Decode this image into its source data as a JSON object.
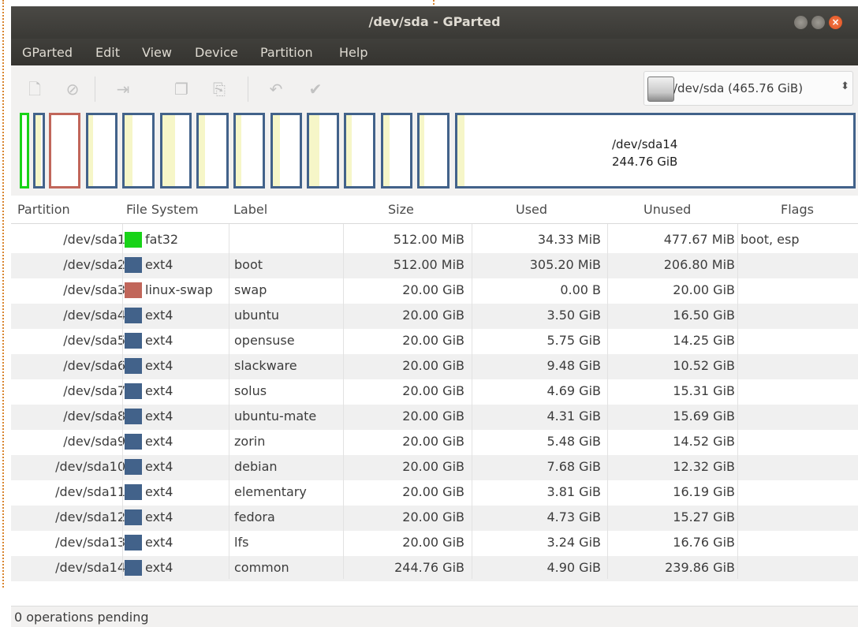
{
  "window": {
    "title": "/dev/sda - GParted"
  },
  "menu": [
    "GParted",
    "Edit",
    "View",
    "Device",
    "Partition",
    "Help"
  ],
  "toolbar": {
    "icons": [
      "new-partition-icon",
      "delete-icon",
      "resize-move-icon",
      "copy-icon",
      "paste-icon",
      "undo-icon",
      "apply-icon"
    ],
    "device": {
      "label": "/dev/sda  (465.76 GiB)",
      "selected": "/dev/sda"
    }
  },
  "partition_map": {
    "highlight_label": "/dev/sda14",
    "highlight_size": "244.76 GiB"
  },
  "table": {
    "columns": [
      "Partition",
      "File System",
      "Label",
      "Size",
      "Used",
      "Unused",
      "Flags"
    ],
    "rows": [
      {
        "partition": "/dev/sda1",
        "fs": "fat32",
        "color": "#18d318",
        "label": "",
        "size": "512.00 MiB",
        "used": "34.33 MiB",
        "unused": "477.67 MiB",
        "flags": "boot, esp"
      },
      {
        "partition": "/dev/sda2",
        "fs": "ext4",
        "color": "#42628a",
        "label": "boot",
        "size": "512.00 MiB",
        "used": "305.20 MiB",
        "unused": "206.80 MiB",
        "flags": ""
      },
      {
        "partition": "/dev/sda3",
        "fs": "linux-swap",
        "color": "#c1665a",
        "label": "swap",
        "size": "20.00 GiB",
        "used": "0.00 B",
        "unused": "20.00 GiB",
        "flags": ""
      },
      {
        "partition": "/dev/sda4",
        "fs": "ext4",
        "color": "#42628a",
        "label": "ubuntu",
        "size": "20.00 GiB",
        "used": "3.50 GiB",
        "unused": "16.50 GiB",
        "flags": ""
      },
      {
        "partition": "/dev/sda5",
        "fs": "ext4",
        "color": "#42628a",
        "label": "opensuse",
        "size": "20.00 GiB",
        "used": "5.75 GiB",
        "unused": "14.25 GiB",
        "flags": ""
      },
      {
        "partition": "/dev/sda6",
        "fs": "ext4",
        "color": "#42628a",
        "label": "slackware",
        "size": "20.00 GiB",
        "used": "9.48 GiB",
        "unused": "10.52 GiB",
        "flags": ""
      },
      {
        "partition": "/dev/sda7",
        "fs": "ext4",
        "color": "#42628a",
        "label": "solus",
        "size": "20.00 GiB",
        "used": "4.69 GiB",
        "unused": "15.31 GiB",
        "flags": ""
      },
      {
        "partition": "/dev/sda8",
        "fs": "ext4",
        "color": "#42628a",
        "label": "ubuntu-mate",
        "size": "20.00 GiB",
        "used": "4.31 GiB",
        "unused": "15.69 GiB",
        "flags": ""
      },
      {
        "partition": "/dev/sda9",
        "fs": "ext4",
        "color": "#42628a",
        "label": "zorin",
        "size": "20.00 GiB",
        "used": "5.48 GiB",
        "unused": "14.52 GiB",
        "flags": ""
      },
      {
        "partition": "/dev/sda10",
        "fs": "ext4",
        "color": "#42628a",
        "label": "debian",
        "size": "20.00 GiB",
        "used": "7.68 GiB",
        "unused": "12.32 GiB",
        "flags": ""
      },
      {
        "partition": "/dev/sda11",
        "fs": "ext4",
        "color": "#42628a",
        "label": "elementary",
        "size": "20.00 GiB",
        "used": "3.81 GiB",
        "unused": "16.19 GiB",
        "flags": ""
      },
      {
        "partition": "/dev/sda12",
        "fs": "ext4",
        "color": "#42628a",
        "label": "fedora",
        "size": "20.00 GiB",
        "used": "4.73 GiB",
        "unused": "15.27 GiB",
        "flags": ""
      },
      {
        "partition": "/dev/sda13",
        "fs": "ext4",
        "color": "#42628a",
        "label": "lfs",
        "size": "20.00 GiB",
        "used": "3.24 GiB",
        "unused": "16.76 GiB",
        "flags": ""
      },
      {
        "partition": "/dev/sda14",
        "fs": "ext4",
        "color": "#42628a",
        "label": "common",
        "size": "244.76 GiB",
        "used": "4.90 GiB",
        "unused": "239.86 GiB",
        "flags": ""
      }
    ]
  },
  "status": {
    "text": "0 operations pending"
  },
  "colors": {
    "ext4": "#42628a",
    "fat32": "#18d318",
    "swap": "#c1665a",
    "used_fill": "#f6f6c8"
  }
}
